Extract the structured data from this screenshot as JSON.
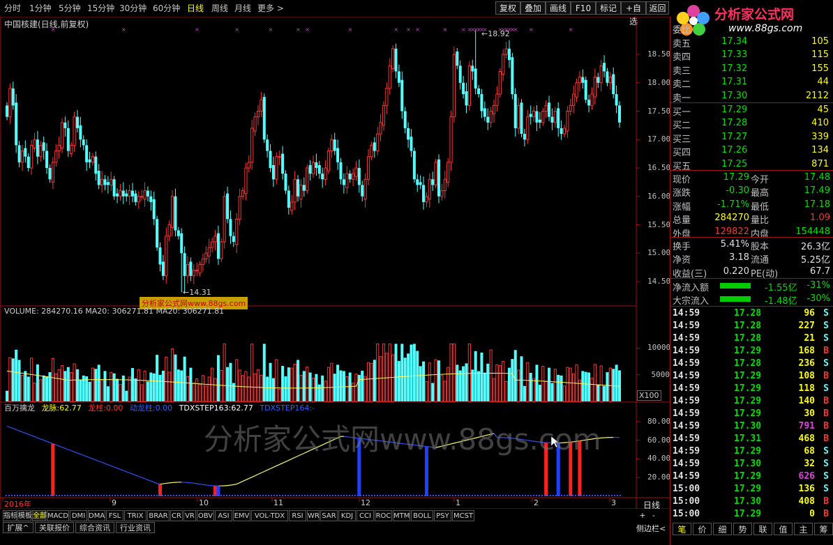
{
  "toolbar": {
    "periods": [
      "分时",
      "1分钟",
      "5分钟",
      "15分钟",
      "30分钟",
      "60分钟",
      "日线",
      "周线",
      "月线",
      "更多 >"
    ],
    "active_period": "日线",
    "buttons": [
      "复权",
      "叠加",
      "画线",
      "F10",
      "标记",
      "+自选",
      "返回"
    ],
    "logo_text": "分析家公式网",
    "logo_url": "www.88gs.com"
  },
  "main_chart": {
    "title": "中国核建(日线,前复权)",
    "high_label": "18.92",
    "low_label": "14.31",
    "watermark_box": "分析家公式网www.88gs.com",
    "y_ticks": [
      "18.50",
      "18.00",
      "17.50",
      "17.00",
      "16.50",
      "16.00",
      "15.50",
      "15.00",
      "14.50"
    ]
  },
  "volume_chart": {
    "header": "VOLUME: 284270.16  MA20: 306271.81  MA20: 306271.81",
    "y_ticks": [
      "10000",
      "5000"
    ],
    "unit": "X100"
  },
  "indicator": {
    "name": "百万擒龙",
    "longmai_label": "龙脉:",
    "longmai_value": "62.77",
    "longzhu_label": "龙柱:",
    "longzhu_value": "0.00",
    "donglongzhu_label": "动龙柱:",
    "donglongzhu_value": "0.00",
    "tdx163_label": "TDXSTEP163:",
    "tdx163_value": "62.77",
    "tdx164_label": "TDXSTEP164:",
    "tdx164_value": "-",
    "y_ticks": [
      "80.00",
      "60.00",
      "40.00",
      "20.00"
    ],
    "watermark": "分析家公式网www.88gs.com"
  },
  "x_axis": {
    "labels": [
      "2016年",
      "9",
      "10",
      "11",
      "12",
      "1",
      "2",
      "3"
    ],
    "period_label": "日线"
  },
  "bottom_tabs": {
    "row1": [
      "指标",
      "模板",
      "全部",
      "MACD",
      "DMI",
      "DMA",
      "FSL",
      "TRIX",
      "BRAR",
      "CR",
      "VR",
      "OBV",
      "ASI",
      "EMV",
      "VOL-TDX",
      "RSI",
      "WR",
      "SAR",
      "KDJ",
      "CCI",
      "ROC",
      "MTM",
      "BOLL",
      "PSY",
      "MCST"
    ],
    "active": "全部",
    "row2": [
      "扩展^",
      "关联报价",
      "综合资讯",
      "行业资讯"
    ],
    "side_label": "侧边栏<",
    "plus": "+",
    "minus": "-"
  },
  "quote": {
    "weibi_label": "委比",
    "sells": [
      {
        "label": "卖五",
        "price": "17.34",
        "vol": "105"
      },
      {
        "label": "卖四",
        "price": "17.33",
        "vol": "115"
      },
      {
        "label": "卖三",
        "price": "17.32",
        "vol": "155"
      },
      {
        "label": "卖二",
        "price": "17.31",
        "vol": "44"
      },
      {
        "label": "卖一",
        "price": "17.30",
        "vol": "2112"
      }
    ],
    "buys": [
      {
        "label": "买一",
        "price": "17.29",
        "vol": "45"
      },
      {
        "label": "买二",
        "price": "17.28",
        "vol": "410"
      },
      {
        "label": "买三",
        "price": "17.27",
        "vol": "339"
      },
      {
        "label": "买四",
        "price": "17.26",
        "vol": "134"
      },
      {
        "label": "买五",
        "price": "17.25",
        "vol": "871"
      }
    ],
    "stats": [
      {
        "l1": "现价",
        "v1": "17.29",
        "l2": "今开",
        "v2": "17.48"
      },
      {
        "l1": "涨跌",
        "v1": "-0.30",
        "l2": "最高",
        "v2": "17.49"
      },
      {
        "l1": "涨幅",
        "v1": "-1.71%",
        "l2": "最低",
        "v2": "17.18"
      },
      {
        "l1": "总量",
        "v1": "284270",
        "l2": "量比",
        "v2": "1.09"
      },
      {
        "l1": "外盘",
        "v1": "129822",
        "l2": "内盘",
        "v2": "154448"
      }
    ],
    "fund": [
      {
        "l1": "换手",
        "v1": "5.41%",
        "l2": "股本",
        "v2": "26.3亿"
      },
      {
        "l1": "净资",
        "v1": "3.18",
        "l2": "流通",
        "v2": "5.25亿"
      },
      {
        "l1": "收益(三)",
        "v1": "0.220",
        "l2": "PE(动)",
        "v2": "67.7"
      }
    ],
    "flows": [
      {
        "label": "净流入额",
        "value": "-1.55亿",
        "pct": "-31%"
      },
      {
        "label": "大宗流入",
        "value": "-1.48亿",
        "pct": "-30%"
      }
    ]
  },
  "ticks": [
    {
      "t": "14:59",
      "p": "17.28",
      "v": "96",
      "d": "S"
    },
    {
      "t": "14:59",
      "p": "17.28",
      "v": "227",
      "d": "S"
    },
    {
      "t": "14:59",
      "p": "17.28",
      "v": "21",
      "d": "S"
    },
    {
      "t": "14:59",
      "p": "17.29",
      "v": "168",
      "d": "B"
    },
    {
      "t": "14:59",
      "p": "17.28",
      "v": "236",
      "d": "S"
    },
    {
      "t": "14:59",
      "p": "17.29",
      "v": "108",
      "d": "B"
    },
    {
      "t": "14:59",
      "p": "17.29",
      "v": "118",
      "d": "S"
    },
    {
      "t": "14:59",
      "p": "17.29",
      "v": "140",
      "d": "B"
    },
    {
      "t": "14:59",
      "p": "17.29",
      "v": "30",
      "d": "B"
    },
    {
      "t": "14:59",
      "p": "17.30",
      "v": "791",
      "d": "B"
    },
    {
      "t": "14:59",
      "p": "17.31",
      "v": "468",
      "d": "B"
    },
    {
      "t": "14:59",
      "p": "17.29",
      "v": "68",
      "d": "S"
    },
    {
      "t": "14:59",
      "p": "17.30",
      "v": "32",
      "d": "S"
    },
    {
      "t": "14:59",
      "p": "17.29",
      "v": "626",
      "d": "S"
    },
    {
      "t": "15:00",
      "p": "17.29",
      "v": "136",
      "d": "S"
    },
    {
      "t": "15:00",
      "p": "17.30",
      "v": "408",
      "d": "B"
    },
    {
      "t": "15:00",
      "p": "17.29",
      "v": "0",
      "d": "B"
    }
  ],
  "right_tabs": [
    "笔",
    "价",
    "细",
    "势",
    "联",
    "值",
    "主",
    "筹"
  ],
  "colors": {
    "up": "#ff3232",
    "down": "#54ffff",
    "sell_vol": "#ffff00",
    "buy": "#ff3232",
    "sell": "#54ffff",
    "flow_bar": "#00cc00",
    "green": "#00e000"
  },
  "chart_data": {
    "type": "candlestick",
    "title": "中国核建(日线,前复权)",
    "price_axis": [
      14.5,
      18.5
    ],
    "high": 18.92,
    "low": 14.31,
    "close": [
      17.4,
      17.9,
      17.6,
      16.9,
      16.6,
      16.8,
      16.7,
      16.5,
      16.9,
      17.0,
      16.7,
      16.9,
      16.8,
      16.5,
      16.3,
      16.6,
      16.8,
      16.9,
      17.3,
      17.2,
      16.8,
      16.9,
      17.4,
      17.2,
      17.0,
      16.9,
      16.6,
      16.6,
      16.7,
      16.4,
      16.2,
      16.3,
      16.2,
      16.2,
      16.3,
      16.0,
      16.0,
      16.1,
      16.0,
      16.0,
      16.1,
      16.0,
      15.9,
      16.0,
      16.0,
      16.1,
      16.0,
      15.9,
      15.6,
      15.1,
      14.8,
      14.6,
      15.3,
      15.5,
      16.0,
      15.4,
      15.3,
      15.0,
      14.6,
      14.8,
      14.6,
      14.7,
      14.7,
      14.8,
      14.9,
      15.0,
      15.1,
      15.2,
      15.3,
      14.9,
      15.2,
      16.0,
      15.6,
      15.3,
      15.2,
      15.6,
      16.0,
      16.1,
      16.5,
      16.6,
      17.2,
      17.4,
      17.5,
      17.7,
      17.0,
      16.8,
      16.5,
      16.3,
      16.7,
      16.7,
      16.4,
      16.1,
      15.8,
      15.9,
      16.3,
      16.0,
      16.2,
      16.1,
      16.5,
      16.4,
      16.6,
      16.5,
      16.4,
      16.3,
      16.5,
      16.8,
      17.0,
      16.8,
      16.6,
      16.3,
      16.2,
      16.4,
      16.3,
      16.4,
      16.5,
      16.2,
      16.0,
      16.3,
      16.7,
      16.9,
      16.8,
      17.1,
      17.3,
      17.6,
      17.9,
      18.3,
      18.6,
      18.2,
      18.0,
      17.5,
      17.2,
      17.0,
      16.8,
      16.3,
      16.2,
      16.2,
      15.9,
      16.0,
      16.3,
      16.2,
      16.6,
      16.0,
      16.1,
      16.3,
      16.6,
      17.4,
      18.5,
      18.3,
      18.0,
      17.8,
      17.6,
      18.3,
      18.2,
      17.9,
      17.8,
      17.5,
      17.4,
      17.3,
      17.5,
      17.6,
      17.8,
      18.2,
      18.5,
      18.6,
      18.4,
      17.8,
      17.2,
      17.6,
      17.1,
      17.0,
      17.4,
      17.4,
      17.5,
      17.3,
      17.3,
      17.5,
      17.6,
      17.4,
      17.3,
      17.5,
      17.2,
      17.1,
      17.2,
      17.5,
      17.6,
      17.8,
      18.0,
      18.1,
      18.0,
      17.7,
      17.6,
      17.8,
      18.1,
      18.0,
      18.3,
      18.2,
      18.0,
      18.1,
      17.8,
      17.6,
      17.3
    ],
    "volume_axis": [
      0,
      10000
    ],
    "volume_ma20": 306271.81,
    "indicator_axis": [
      0,
      100
    ],
    "longmai": 62.77,
    "x_labels": [
      "2016年",
      "9",
      "10",
      "11",
      "12",
      "1",
      "2",
      "3"
    ]
  }
}
